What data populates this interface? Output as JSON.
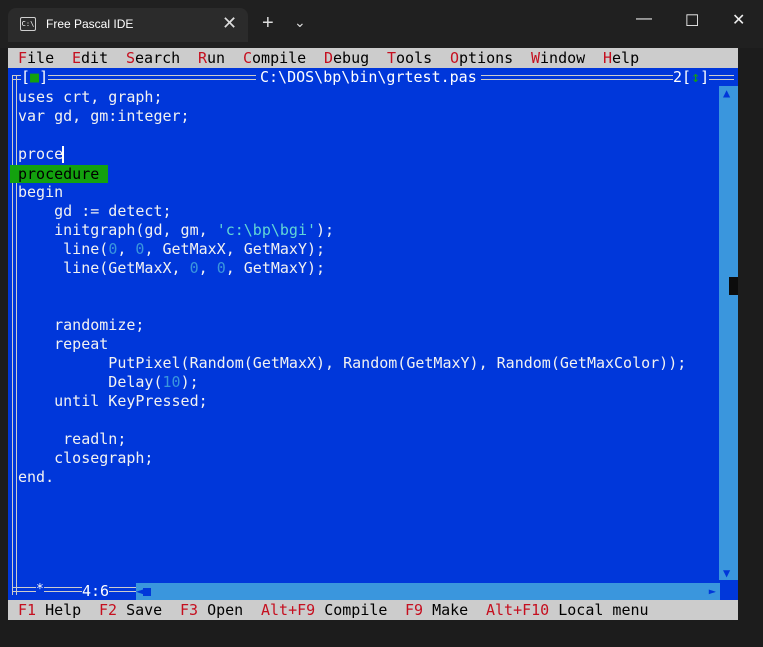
{
  "window": {
    "tab_title": "Free Pascal IDE",
    "tab_icon": "C:\\",
    "tab_close": "✕",
    "new_tab": "+",
    "tab_dropdown": "⌄",
    "minimize": "—",
    "maximize": "☐",
    "close": "✕"
  },
  "menu": [
    {
      "hot": "F",
      "rest": "ile"
    },
    {
      "hot": "E",
      "rest": "dit"
    },
    {
      "hot": "S",
      "rest": "earch"
    },
    {
      "hot": "R",
      "rest": "un"
    },
    {
      "hot": "C",
      "rest": "ompile"
    },
    {
      "hot": "D",
      "rest": "ebug"
    },
    {
      "hot": "T",
      "rest": "ools"
    },
    {
      "hot": "O",
      "rest": "ptions"
    },
    {
      "hot": "W",
      "rest": "indow"
    },
    {
      "hot": "H",
      "rest": "elp"
    }
  ],
  "editor": {
    "file_path": "C:\\DOS\\bp\\bin\\grtest.pas",
    "close_box": "■",
    "window_number": "2",
    "zoom_icon": "↕",
    "cursor_position": "4:6",
    "modified_marker": "*",
    "autocomplete_suggestion": "procedure",
    "lines": [
      "uses crt, graph;",
      "var gd, gm:integer;",
      "",
      "proce",
      "",
      "begin",
      "    gd := detect;",
      "    initgraph(gd, gm, 'c:\\bp\\bgi');",
      "     line(0, 0, GetMaxX, GetMaxY);",
      "     line(GetMaxX, 0, 0, GetMaxY);",
      "",
      "",
      "    randomize;",
      "    repeat",
      "          PutPixel(Random(GetMaxX), Random(GetMaxY), Random(GetMaxColor));",
      "          Delay(10);",
      "    until KeyPressed;",
      "",
      "     readln;",
      "    closegraph;",
      "end."
    ]
  },
  "status": [
    {
      "key": "F1",
      "label": "Help"
    },
    {
      "key": "F2",
      "label": "Save"
    },
    {
      "key": "F3",
      "label": "Open"
    },
    {
      "key": "Alt+F9",
      "label": "Compile"
    },
    {
      "key": "F9",
      "label": "Make"
    },
    {
      "key": "Alt+F10",
      "label": "Local menu"
    }
  ],
  "colors": {
    "editor_bg": "#0037da",
    "menu_bg": "#cccccc",
    "hotkey": "#c50f1f",
    "number": "#3a96dd",
    "string": "#61d6d6",
    "autocomplete_bg": "#13a10e"
  }
}
